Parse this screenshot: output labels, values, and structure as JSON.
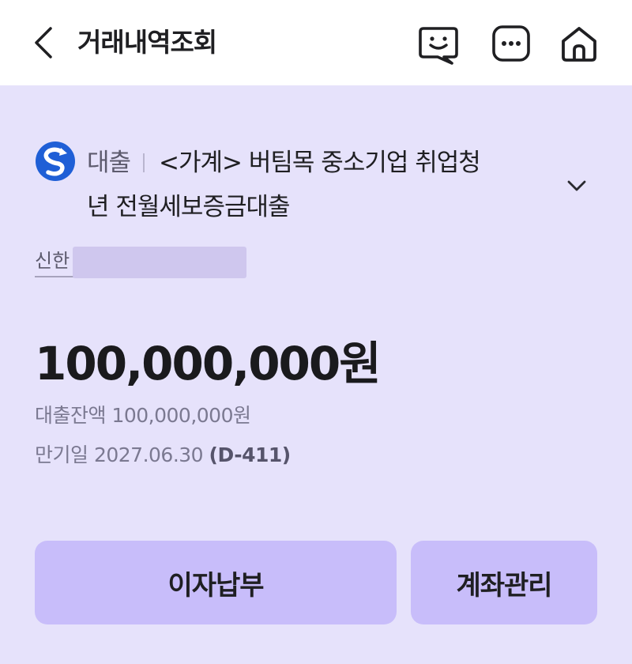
{
  "header": {
    "title": "거래내역조회",
    "icons": [
      "chevron-left-icon",
      "chat-face-icon",
      "more-icon",
      "home-icon"
    ]
  },
  "loan": {
    "type": "대출",
    "name_line1": "<가계> 버팀목 중소기업 취업청",
    "name_line2": "년 전월세보증금대출",
    "account_prefix": "신한"
  },
  "amount": {
    "main": "100,000,000원",
    "balance": "대출잔액 100,000,000원",
    "maturity": "만기일 2027.06.30",
    "dday": "(D-411)"
  },
  "actions": {
    "interest_payment": "이자납부",
    "account_management": "계좌관리"
  },
  "colors": {
    "background": "#e6e2fb",
    "button": "#c8bdfa",
    "logo_blue": "#1f5fd6"
  }
}
